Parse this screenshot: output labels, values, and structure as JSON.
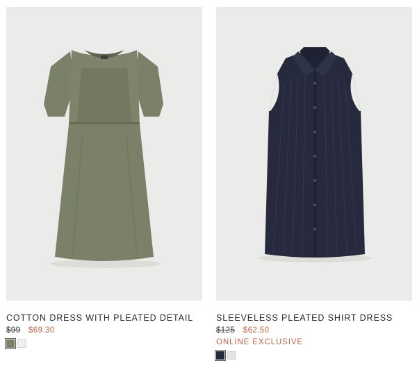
{
  "products": [
    {
      "name": "COTTON DRESS WITH PLEATED DETAIL",
      "original_price": "$99",
      "sale_price": "$69.30",
      "tag": "",
      "swatches": [
        {
          "color": "#7a7f68"
        },
        {
          "color": "#f2f1ec"
        }
      ],
      "image_icon": "khaki-tshirt-dress-image"
    },
    {
      "name": "SLEEVELESS PLEATED SHIRT DRESS",
      "original_price": "$125",
      "sale_price": "$62.50",
      "tag": "ONLINE EXCLUSIVE",
      "swatches": [
        {
          "color": "#252a3d"
        },
        {
          "color": "#e4e4e2"
        }
      ],
      "image_icon": "navy-shirt-dress-image"
    }
  ]
}
